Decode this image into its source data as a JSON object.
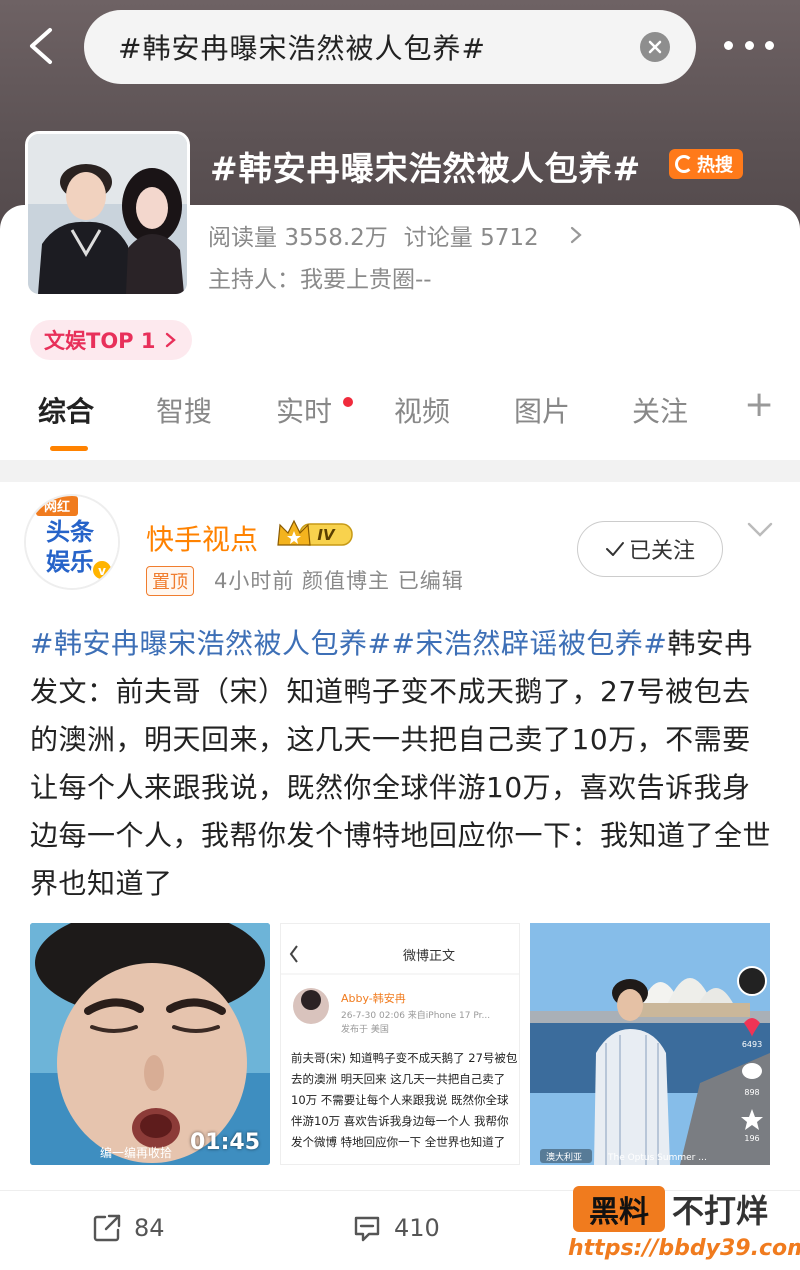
{
  "search": {
    "query": "#韩安冉曝宋浩然被人包养#"
  },
  "topic": {
    "title": "#韩安冉曝宋浩然被人包养#",
    "hot_label": "热搜",
    "reads_label": "阅读量",
    "reads_value": "3558.2万",
    "discuss_label": "讨论量",
    "discuss_value": "5712",
    "host_label": "主持人：",
    "host_value": "我要上贵圈--",
    "rank_label": "文娱TOP 1"
  },
  "tabs": [
    {
      "label": "综合"
    },
    {
      "label": "智搜"
    },
    {
      "label": "实时"
    },
    {
      "label": "视频"
    },
    {
      "label": "图片"
    },
    {
      "label": "关注"
    },
    {
      "label": "+"
    }
  ],
  "post": {
    "avatar_badge": "网红",
    "avatar_text1": "头条",
    "avatar_text2": "娱乐",
    "author": "快手视点",
    "level": "IV",
    "pinned": "置顶",
    "meta": "4小时前  颜值博主  已编辑",
    "follow_label": "已关注",
    "hashtag1": "#韩安冉曝宋浩然被人包养#",
    "hashtag2": "#宋浩然辟谣被包养#",
    "body": "韩安冉发文：前夫哥（宋）知道鸭子变不成天鹅了，27号被包去的澳洲，明天回来，这几天一共把自己卖了10万，不需要让每个人来跟我说，既然你全球伴游10万，喜欢告诉我身边每一个人，我帮你发个博特地回应你一下：我知道了全世界也知道了",
    "video_duration": "01:45",
    "video_caption": "编一编再收拾"
  },
  "screenshot": {
    "title": "微博正文",
    "author": "Abby-韩安冉",
    "meta": "26-7-30 02:06  来自iPhone 17 Pr...",
    "location": "发布于 美国",
    "text": "前夫哥(宋) 知道鸭子变不成天鹅了 27号被包去的澳洲 明天回来 这几天一共把自己卖了10万 不需要让每个人来跟我说 既然你全球伴游10万 喜欢告诉我身边每一个人 我帮你发个微博 特地回应你一下 全世界也知道了"
  },
  "photo": {
    "location_tag": "澳大利亚",
    "music_tag": "The Optus Summer ...",
    "likes": "6493",
    "comments": "898",
    "favorites": "196"
  },
  "actions": {
    "repost": "84",
    "comment": "410"
  },
  "watermark": {
    "left": "黑料",
    "right": "不打烊",
    "url": "https://bbdy39.com"
  }
}
